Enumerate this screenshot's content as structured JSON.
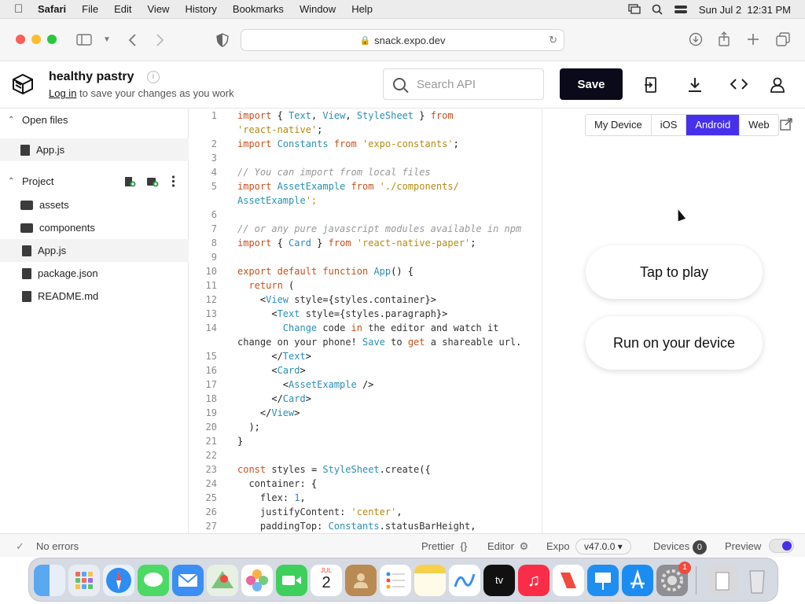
{
  "menubar": {
    "app": "Safari",
    "items": [
      "File",
      "Edit",
      "View",
      "History",
      "Bookmarks",
      "Window",
      "Help"
    ],
    "clock": "Sun Jul 2  12:31 PM"
  },
  "browser": {
    "url": "snack.expo.dev"
  },
  "header": {
    "title": "healthy pastry",
    "login_link": "Log in",
    "login_rest": " to save your changes as you work",
    "search_placeholder": "Search API",
    "save_label": "Save"
  },
  "sidebar": {
    "open_files_label": "Open files",
    "open_files": [
      "App.js"
    ],
    "project_label": "Project",
    "project_items": [
      {
        "name": "assets",
        "type": "folder"
      },
      {
        "name": "components",
        "type": "folder"
      },
      {
        "name": "App.js",
        "type": "file"
      },
      {
        "name": "package.json",
        "type": "file"
      },
      {
        "name": "README.md",
        "type": "file"
      }
    ]
  },
  "editor": {
    "lines": [
      {
        "n": "1",
        "t": "import { Text, View, StyleSheet } from"
      },
      {
        "n": "",
        "t": "'react-native';"
      },
      {
        "n": "2",
        "t": "import Constants from 'expo-constants';"
      },
      {
        "n": "3",
        "t": ""
      },
      {
        "n": "4",
        "t": "// You can import from local files"
      },
      {
        "n": "5",
        "t": "import AssetExample from './components/"
      },
      {
        "n": "",
        "t": "AssetExample';"
      },
      {
        "n": "6",
        "t": ""
      },
      {
        "n": "7",
        "t": "// or any pure javascript modules available in npm"
      },
      {
        "n": "8",
        "t": "import { Card } from 'react-native-paper';"
      },
      {
        "n": "9",
        "t": ""
      },
      {
        "n": "10",
        "t": "export default function App() {"
      },
      {
        "n": "11",
        "t": "  return ("
      },
      {
        "n": "12",
        "t": "    <View style={styles.container}>"
      },
      {
        "n": "13",
        "t": "      <Text style={styles.paragraph}>"
      },
      {
        "n": "14",
        "t": "        Change code in the editor and watch it"
      },
      {
        "n": "",
        "t": "change on your phone! Save to get a shareable url."
      },
      {
        "n": "15",
        "t": "      </Text>"
      },
      {
        "n": "16",
        "t": "      <Card>"
      },
      {
        "n": "17",
        "t": "        <AssetExample />"
      },
      {
        "n": "18",
        "t": "      </Card>"
      },
      {
        "n": "19",
        "t": "    </View>"
      },
      {
        "n": "20",
        "t": "  );"
      },
      {
        "n": "21",
        "t": "}"
      },
      {
        "n": "22",
        "t": ""
      },
      {
        "n": "23",
        "t": "const styles = StyleSheet.create({"
      },
      {
        "n": "24",
        "t": "  container: {"
      },
      {
        "n": "25",
        "t": "    flex: 1,"
      },
      {
        "n": "26",
        "t": "    justifyContent: 'center',"
      },
      {
        "n": "27",
        "t": "    paddingTop: Constants.statusBarHeight,"
      }
    ]
  },
  "preview": {
    "tabs": [
      "My Device",
      "iOS",
      "Android",
      "Web"
    ],
    "active_tab": "Android",
    "tap_to_play": "Tap to play",
    "run_on_device": "Run on your device"
  },
  "status": {
    "errors": "No errors",
    "prettier": "Prettier",
    "prettier_glyph": "{}",
    "editor": "Editor",
    "expo": "Expo",
    "version": "v47.0.0",
    "devices": "Devices",
    "devices_count": "0",
    "preview": "Preview"
  },
  "dock": {
    "calendar_month": "JUL",
    "calendar_day": "2",
    "settings_badge": "1",
    "tv_label": "tv"
  },
  "colors": {
    "accent": "#4630eb",
    "save_bg": "#0a0a1a"
  }
}
